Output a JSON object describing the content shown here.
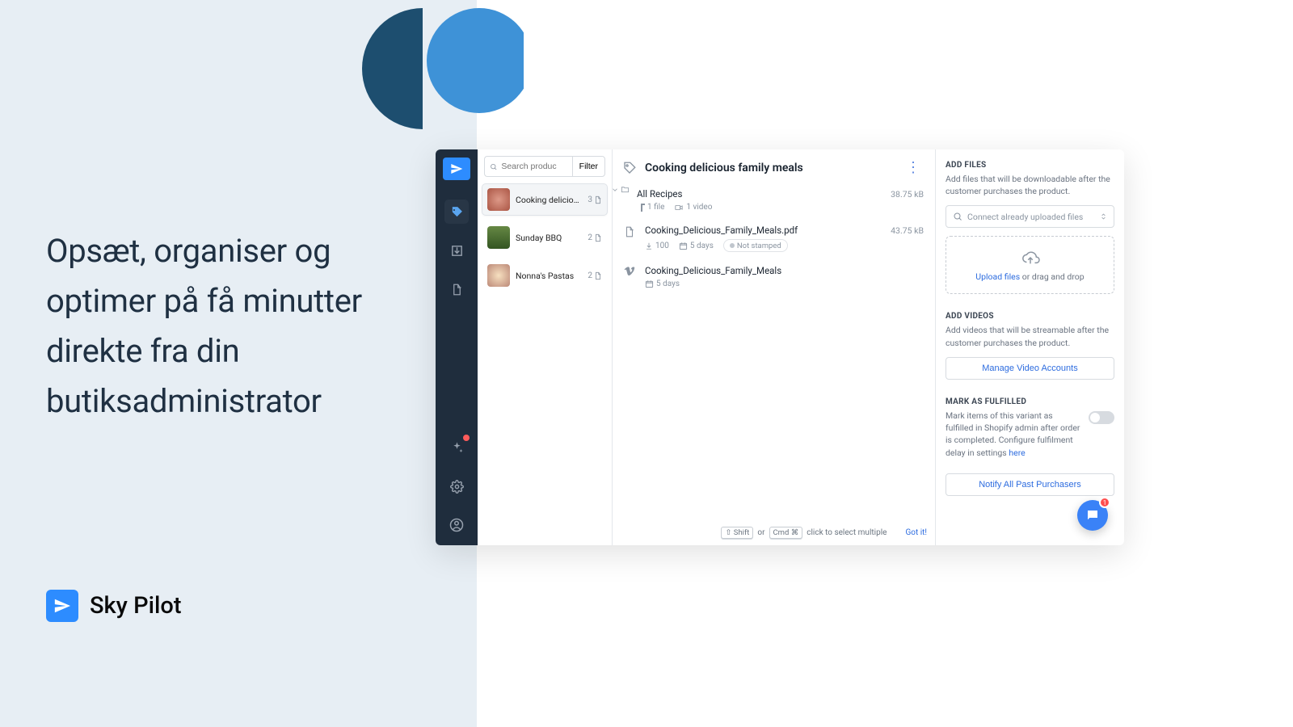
{
  "hero_text": "Opsæt, organiser og optimer på få minutter direkte fra din butiksadministrator",
  "logo_name": "Sky Pilot",
  "search": {
    "placeholder": "Search produc",
    "filter_label": "Filter"
  },
  "products": [
    {
      "name": "Cooking delicious f…",
      "count": "3"
    },
    {
      "name": "Sunday BBQ",
      "count": "2"
    },
    {
      "name": "Nonna's Pastas",
      "count": "2"
    }
  ],
  "main": {
    "title": "Cooking delicious family meals",
    "rows": [
      {
        "kind": "folder",
        "title": "All Recipes",
        "meta_file": "1 file",
        "meta_video": "1 video",
        "size": "38.75 kB"
      },
      {
        "kind": "file",
        "title": "Cooking_Delicious_Family_Meals.pdf",
        "downloads": "100",
        "days": "5 days",
        "stamp": "Not stamped",
        "size": "43.75 kB"
      },
      {
        "kind": "video",
        "title": "Cooking_Delicious_Family_Meals",
        "days": "5 days"
      }
    ],
    "hint_shift": "⇧ Shift",
    "hint_or": "or",
    "hint_cmd": "Cmd ⌘",
    "hint_text": "click to select multiple",
    "hint_gotit": "Got it!"
  },
  "side": {
    "add_files_h": "ADD FILES",
    "add_files_p": "Add files that will be downloadable after the customer purchases the product.",
    "connect_label": "Connect already uploaded files",
    "upload_link": "Upload files",
    "upload_rest": " or drag and drop",
    "add_videos_h": "ADD VIDEOS",
    "add_videos_p": "Add videos that will be streamable after the customer purchases the product.",
    "manage_video": "Manage Video Accounts",
    "mark_h": "MARK AS FULFILLED",
    "mark_p": "Mark items of this variant as fulfilled in Shopify admin after order is completed. Configure fulfilment delay in settings ",
    "mark_link": "here",
    "notify": "Notify All Past Purchasers"
  },
  "chat_badge": "1"
}
